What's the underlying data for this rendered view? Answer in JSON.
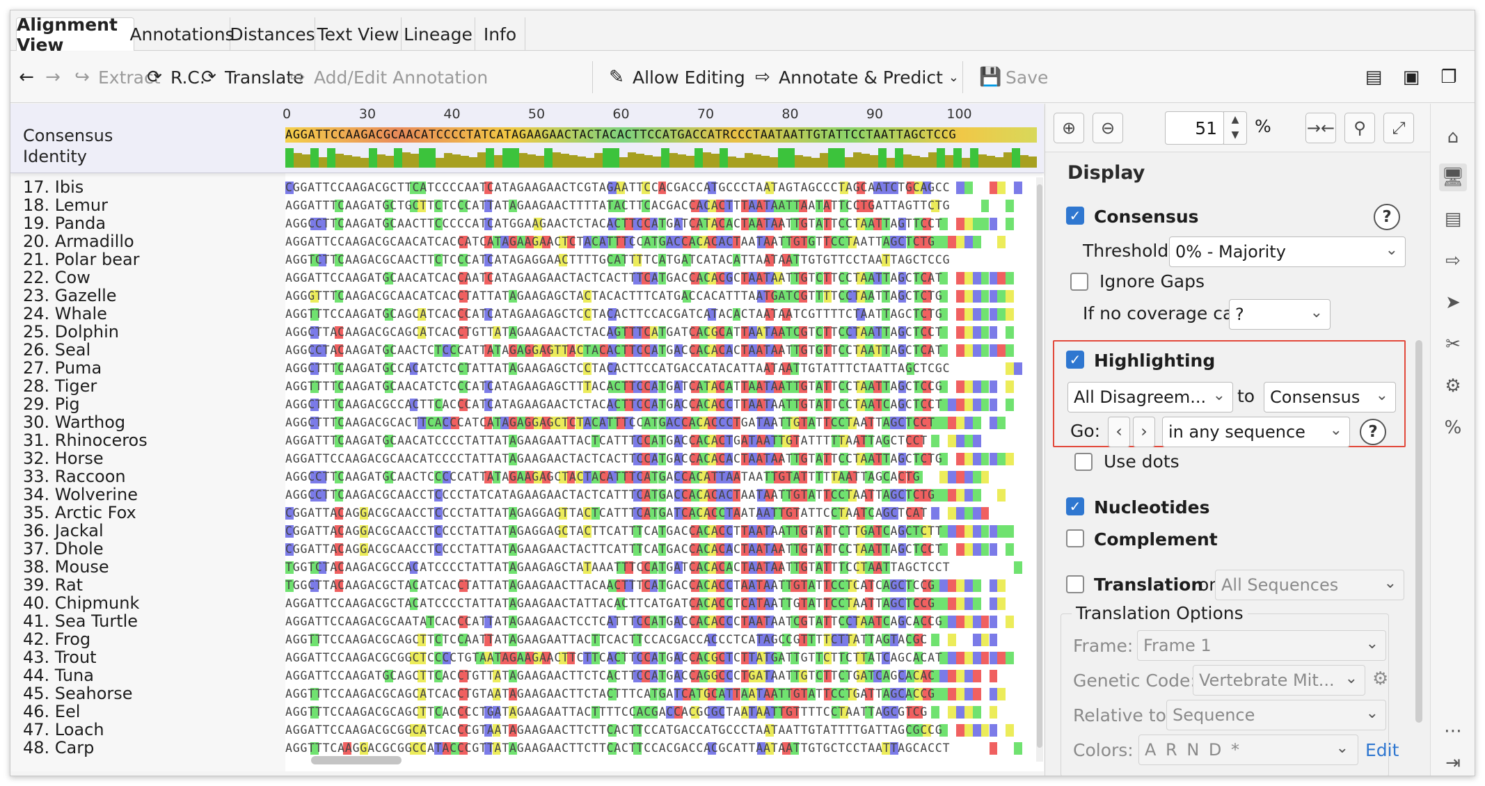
{
  "tabs": [
    "Alignment View",
    "Annotations",
    "Distances",
    "Text View",
    "Lineage",
    "Info"
  ],
  "toolbar": {
    "back_icon": "arrow-left-icon",
    "forward_icon": "arrow-right-icon",
    "extract": "Extract",
    "rc": "R.C.",
    "translate": "Translate",
    "add_edit_annotation": "Add/Edit Annotation",
    "allow_editing": "Allow Editing",
    "annotate_predict": "Annotate & Predict",
    "save": "Save"
  },
  "ruler": [
    "0",
    "30",
    "40",
    "50",
    "60",
    "70",
    "80",
    "90",
    "100"
  ],
  "consensus_label": "Consensus",
  "identity_label": "Identity",
  "consensus_seq": "AGGATTCCAAGACGCAACATCCCCTATCATAGAAGAACTACTACACTTCCATGACCATRCCCTAATAATTGTATTCCTAATTAGCTCCG",
  "sequences": [
    {
      "name": "17. Ibis",
      "seq": "CGGATTCCAAGACGCTTCATCCCCAATCATAGAAGAACTCGTAGAATTCCACGACCATGCCCTAATAGTAGCCCTAGCAATCTGCAGCC"
    },
    {
      "name": "18. Lemur",
      "seq": "AGGATTTCAAGATGCTGCTTCTCCCATTATAGAAGAACTTTTATACTTCACGACCACACTTTAATAATTAATATTCCTGATTAGTTCTG"
    },
    {
      "name": "19. Panda",
      "seq": "AGGCCTTCAAGATGCAACTTCCCCCATCATGGAAGAACTCTACACTTCCATGATCATACACTAATAATTGTATTCCTAATTAGTTCCT"
    },
    {
      "name": "20. Armadillo",
      "seq": "AGGATTCCAAGACGCAACATCACCATCATAGAAGAACTCTACATTTCCATGACCACACACTAATAATTGTGTTCCTAATTAGCTCTG"
    },
    {
      "name": "21. Polar bear",
      "seq": "AGGTCTTCAAGACGCAACTTCTCCCATCATAGAGGAACTTTTGCATTTTCATGATCATACATTAATAATTGTGTTCCTAATTAGCTCCG"
    },
    {
      "name": "22. Cow",
      "seq": "AGGATTCCAAGATGCAACATCACCAATCATAGAAGAACTACTCACTTTCATGACCACACGCTAATAATTGTCTTCCTAATTAGCTCAT"
    },
    {
      "name": "23. Gazelle",
      "seq": "AGGGTTTCAAGACGCAACATCACCTATTATAGAAGAGCTACTACACTTTCATGACCACATTTAATGATCGTTTTCCTAATTAGCTCTG"
    },
    {
      "name": "24. Whale",
      "seq": "AGGTTTCCAAGATGCAGCATCACCCATCATAGAAGAGCTCCTACACTTCCACGATCATACACTAATAATCGTTTTCTAATTAGCTCTG"
    },
    {
      "name": "25. Dolphin",
      "seq": "AGGCTTACAAGACGCAGCATCACCTGTTATAGAAGAACTCTACAGTTTCATGATCACGCATTAATAATCGTCTTCCTAATTAGCTCCT"
    },
    {
      "name": "26. Seal",
      "seq": "AGGCCTACAAGATGCAACTCTCCCATTATAGAGGAGTTACTACACTTCCATGACCACACACTAATAATTGTGTTCCTAATTAGCTCAT"
    },
    {
      "name": "27. Puma",
      "seq": "AGGCTTTCAAGATGCCACATCTCCTATTATAGAAGAGCTCCTACACTTCCATGACCATACATTAATAATTGTATTTCTAATTAGCTCGC"
    },
    {
      "name": "28. Tiger",
      "seq": "AGGTTTTCAAGATGCAACATCTCCCATCATAGAAGAGCTTTACACTTCCATGATCATACATTAATAATTGTATTCCTAATTAGCTCCG"
    },
    {
      "name": "29. Pig",
      "seq": "AGGCTTTCAAGACGCCACTTCACCCATCATAGAAGAACTCTACACTTCCATGACCACACCTTAATAATTGTATTCCTAATCAGCTCCT"
    },
    {
      "name": "30. Warthog",
      "seq": "AGGCTTTCAAGACGCACTTCACCCATCATAGAGGAGCTCTACATTTCCATGACCACACCCTGATAATTGTATTCCTAATTAGCTCCT"
    },
    {
      "name": "31. Rhinoceros",
      "seq": "AGGATTTCAAGATGCAACATCCCCTATTATAGAAGAATTACTCATTTCCATGACCACACTGATAATTGTATTTTTAATTAGCTCCT"
    },
    {
      "name": "32. Horse",
      "seq": "AGGATTCCAAGACGCAACATCCCCTATTATAGAAGAACTACTCACTTCCATGACCACACACTAATAATTGTATTCCTAATTAGCTCTG"
    },
    {
      "name": "33. Raccoon",
      "seq": "AGGCCTTCAAGATGCAACTCCCCCATTATAGAAGAGCTACTACATTTCATGACCACATTAATAATTGTATTTTTAATTAGCACTG"
    },
    {
      "name": "34. Wolverine",
      "seq": "AGGCCTTCAAGACGCAACCTCCCCTATCATAGAAGAACTACTCATTTCATGACCACACACTAATAATTGTATTCCTAATTAGCTCTG"
    },
    {
      "name": "35. Arctic Fox",
      "seq": "CGGATTACAGGACGCAACCTCCCCTATTATAGAGGAGTTACTCATTTCATGATCACACCTAATAATTGTATTCCTAATCAGCTCAT"
    },
    {
      "name": "36. Jackal",
      "seq": "CGGATTACAGGACGCAACCTCCCCTATTATAGAGGAGCTACTTCATTTCATGACCACACCTTAATAATTGTATTCTTGATCAGCTCTT"
    },
    {
      "name": "37. Dhole",
      "seq": "CGGATTACAGGACGCAACCTCCCCTATTATAGAAGAACTACTTCATTTCATGACCACACACTAATAATTGTATTCCTAATTAGCTCCT"
    },
    {
      "name": "38. Mouse",
      "seq": "TGGTCTACAAGACGCCACATCCCCTATTATAGAAGAGCTATAAATTTCCATGATCACACACTAATAATTGTATTTCCTAATTAGCTCCT"
    },
    {
      "name": "39. Rat",
      "seq": "TGGCTTACAAGACGCTACATCACCTATTATAGAAGAACTTACAACTTTCATGACCACACCTAATAATTGTATTCCTCATCAGCTCCG"
    },
    {
      "name": "40. Chipmunk",
      "seq": "AGGATTCCAAGACGCTACATCCCCTATTATAGAAGAACTATTACACTTCATGATCACACCTCATAATTGTATTCCTAATTAGCTCCG"
    },
    {
      "name": "41. Sea Turtle",
      "seq": "AGGATTCCAAGACGCAATATCACCCATTATAGAAGAACTCCTCATTTCCATGACCACACCCTAATAATCGTATTCCTAATCAGCACCG"
    },
    {
      "name": "42. Frog",
      "seq": "AGGTTTCCAAGACGCAGCTTCTCCAATTATAGAAGAATTACTTCACTTCCACGACCACCCTCATAGCCGTTTTCTTATTAGTACGC"
    },
    {
      "name": "43. Trout",
      "seq": "AGGATTCCAAGACGCGGCTCCCCTGTAATAGAAGAACTTCTTCACTTCCATGACCACGCTCTTATGATTGTTCTTCTTATCAGCACAT"
    },
    {
      "name": "44. Tuna",
      "seq": "AGGATTCCAAGATGCAGCTTCACCTGTTATAGAAGAACTTCTCACTTCCATGACCAGGCCCTGATAATTGTCTTCTGATCAGCACAC"
    },
    {
      "name": "45. Seahorse",
      "seq": "AGGTTTCCAAGACGCAGCATCACCTGTAATAGAAGAACTTCTACTTTCATGATCATGCATTAATAATTGTATTCCTGATTAGCACCG"
    },
    {
      "name": "46. Eel",
      "seq": "AGGTTTCCAAGACGCAGCTTCACCCCTGATAGAAGAATTACTTTTCCACGACCACGCGCTAATAATTGTTTTCCTAATTAGCGTCG"
    },
    {
      "name": "47. Loach",
      "seq": "AGGATTCCAAGACGCGGCATCACCCGTAATAGAAGAACTTCTTCACTTCCATGACCATGCCCTAATAATTGTATTTTGATTAGCGCCG"
    },
    {
      "name": "48. Carp",
      "seq": "AGGTTTCAAGGACGCGGCCATACCCGTTATAGAAGAACTTCTTCACTTCCACGACCACGCATTAATAATTGTGCTCCTAATTAGCACCT"
    }
  ],
  "panel": {
    "zoom_value": "51",
    "zoom_unit": "%",
    "display_title": "Display",
    "consensus": "Consensus",
    "threshold_label": "Threshold:",
    "threshold_value": "0% - Majority",
    "ignore_gaps": "Ignore Gaps",
    "no_coverage_label": "If no coverage call",
    "no_coverage_value": "?",
    "highlighting": "Highlighting",
    "highlight_mode": "All Disagreem...",
    "to_label": "to",
    "highlight_target": "Consensus",
    "go_label": "Go:",
    "go_scope": "in any sequence",
    "use_dots": "Use dots",
    "nucleotides": "Nucleotides",
    "complement": "Complement",
    "translation_label": "Translation",
    "translation_on": "on",
    "translation_scope": "All Sequences",
    "translation_options": "Translation Options",
    "frame_label": "Frame:",
    "frame_value": "Frame 1",
    "genetic_code_label": "Genetic Code:",
    "genetic_code_value": "Vertebrate Mit...",
    "relative_label": "Relative to:",
    "relative_value": "Sequence",
    "colors_label": "Colors:",
    "colors_value": "A R N D *",
    "edit_link": "Edit"
  },
  "colors": {
    "A": "#f06060",
    "C": "#7b7be8",
    "G": "#ecec5a",
    "T": "#70e270",
    "accent": "#2f77d0",
    "highlight_border": "#e2483a"
  }
}
